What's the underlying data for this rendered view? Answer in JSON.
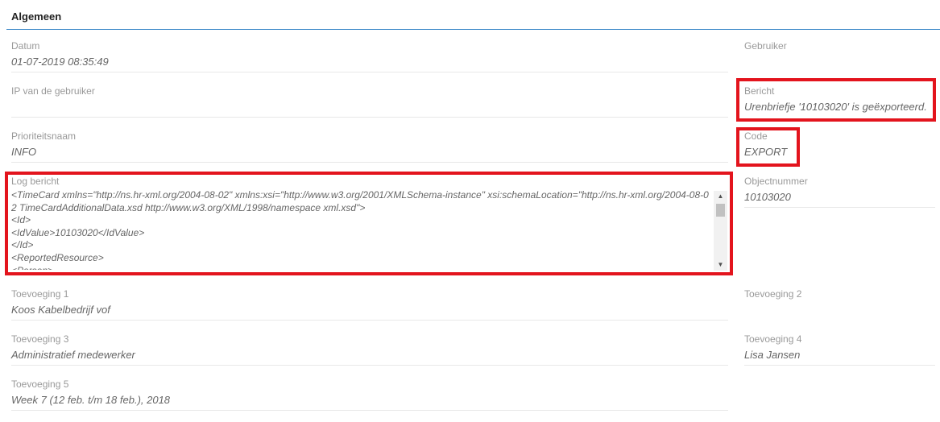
{
  "section": {
    "title": "Algemeen"
  },
  "fields": {
    "datum": {
      "label": "Datum",
      "value": "01-07-2019 08:35:49"
    },
    "gebruiker": {
      "label": "Gebruiker",
      "value": ""
    },
    "ip": {
      "label": "IP van de gebruiker",
      "value": ""
    },
    "bericht": {
      "label": "Bericht",
      "value": "Urenbriefje '10103020' is geëxporteerd."
    },
    "prioriteit": {
      "label": "Prioriteitsnaam",
      "value": "INFO"
    },
    "code": {
      "label": "Code",
      "value": "EXPORT"
    },
    "log": {
      "label": "Log bericht",
      "value": "<TimeCard xmlns=\"http://ns.hr-xml.org/2004-08-02\" xmlns:xsi=\"http://www.w3.org/2001/XMLSchema-instance\" xsi:schemaLocation=\"http://ns.hr-xml.org/2004-08-02 TimeCardAdditionalData.xsd http://www.w3.org/XML/1998/namespace xml.xsd\">\n<Id>\n<IdValue>10103020</IdValue>\n</Id>\n<ReportedResource>\n<Person>"
    },
    "objectnummer": {
      "label": "Objectnummer",
      "value": "10103020"
    },
    "toevoeging1": {
      "label": "Toevoeging 1",
      "value": "Koos Kabelbedrijf vof"
    },
    "toevoeging2": {
      "label": "Toevoeging 2",
      "value": ""
    },
    "toevoeging3": {
      "label": "Toevoeging 3",
      "value": "Administratief medewerker"
    },
    "toevoeging4": {
      "label": "Toevoeging 4",
      "value": "Lisa Jansen"
    },
    "toevoeging5": {
      "label": "Toevoeging 5",
      "value": "Week 7 (12 feb. t/m 18 feb.), 2018"
    }
  },
  "icons": {
    "scroll_up": "arrow-up-icon",
    "scroll_down": "arrow-down-icon"
  },
  "colors": {
    "accent_rule": "#3a87c8",
    "highlight": "#e3141d"
  }
}
